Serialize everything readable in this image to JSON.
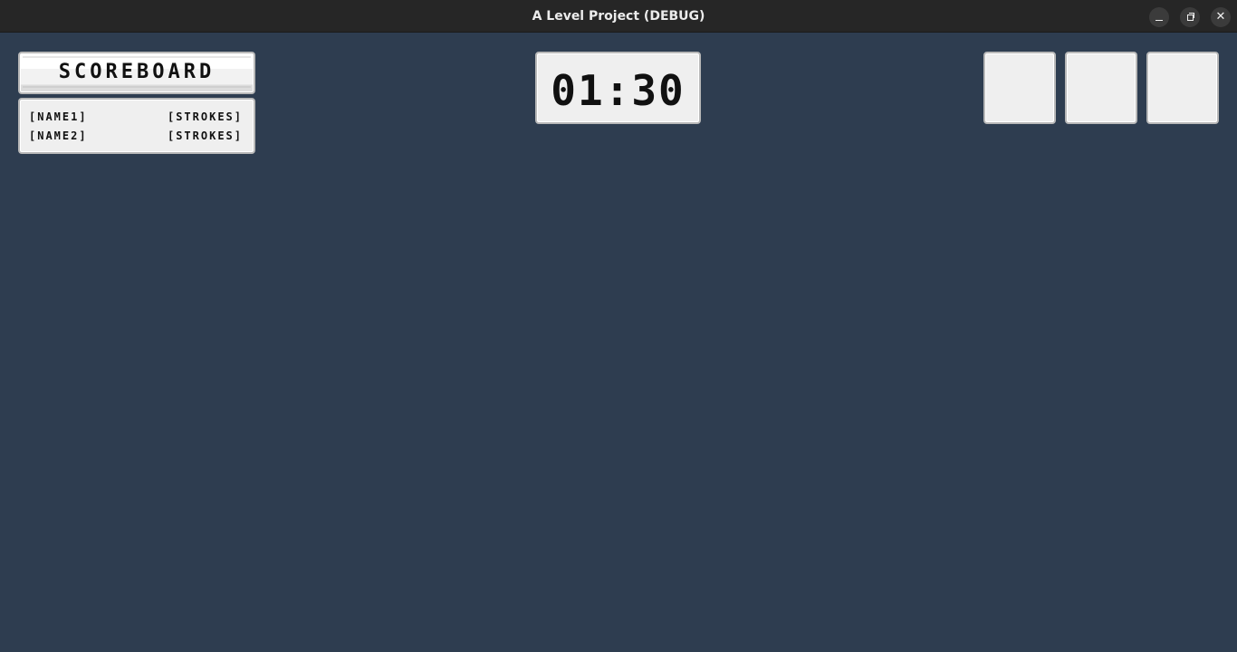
{
  "window": {
    "title": "A Level Project (DEBUG)",
    "controls": {
      "minimize_icon": "minimize-icon",
      "maximize_icon": "restore-icon",
      "close_label": "✕"
    }
  },
  "scoreboard": {
    "title": "SCOREBOARD",
    "rows": [
      {
        "name": "[NAME1]",
        "strokes": "[STROKES]"
      },
      {
        "name": "[NAME2]",
        "strokes": "[STROKES]"
      }
    ]
  },
  "timer": {
    "value": "01:30"
  },
  "slots": [
    {
      "content": ""
    },
    {
      "content": ""
    },
    {
      "content": ""
    }
  ],
  "colors": {
    "background": "#2e3d50",
    "titlebar": "#262626",
    "panel": "#efefef",
    "panel_border": "#b8b8b8",
    "text": "#111111"
  }
}
